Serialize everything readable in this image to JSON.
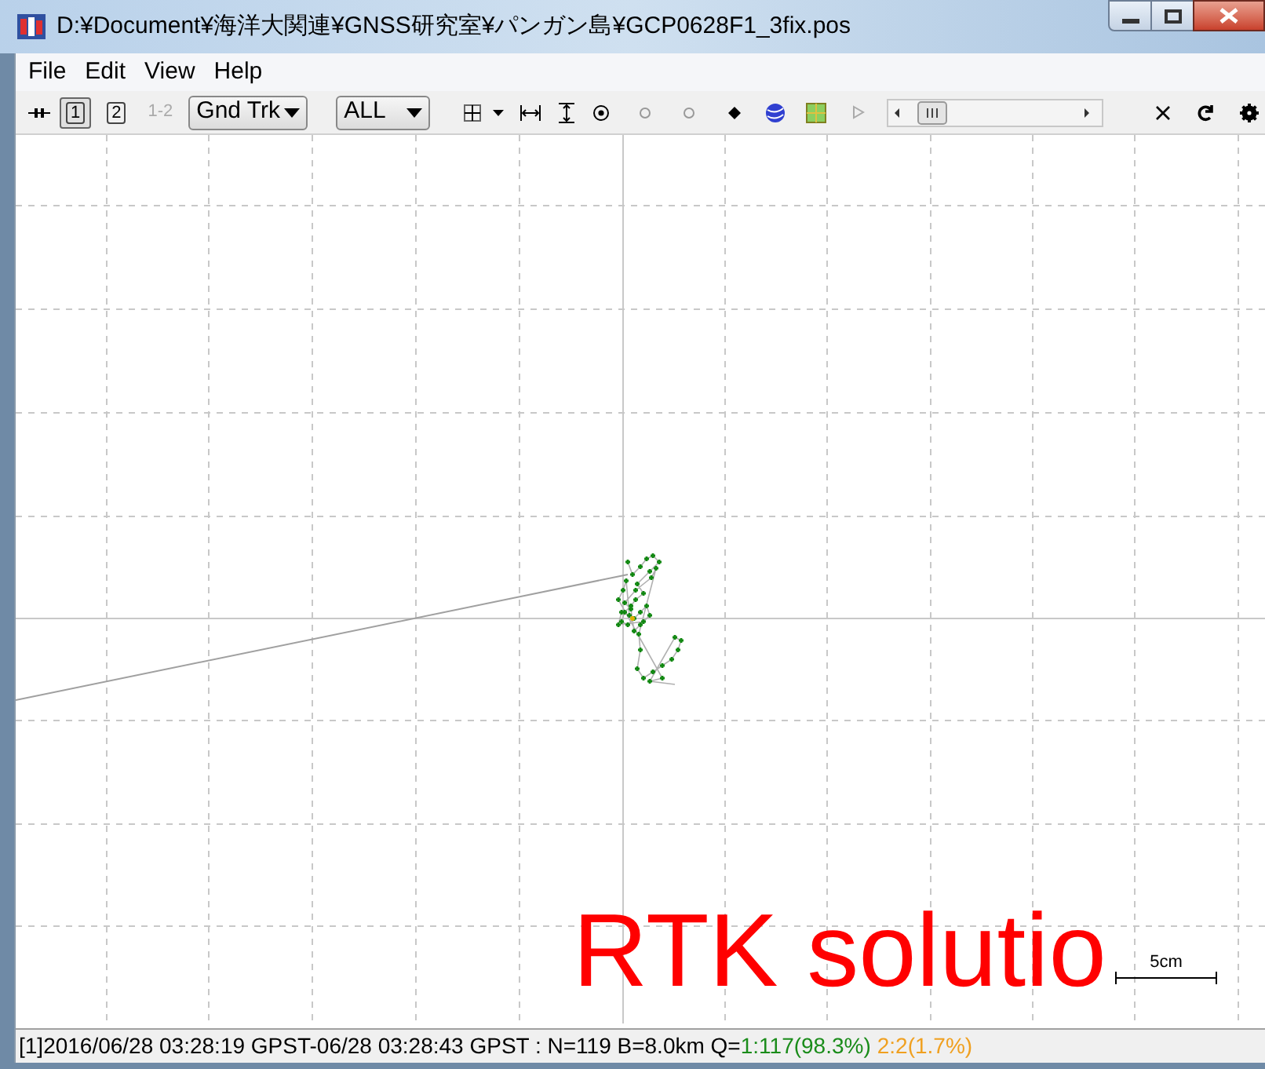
{
  "window": {
    "title": "D:¥Document¥海洋大関連¥GNSS研究室¥パンガン島¥GCP0628F1_3fix.pos"
  },
  "menu": [
    "File",
    "Edit",
    "View",
    "Help"
  ],
  "toolbar": {
    "plot_buttons": [
      {
        "label": "1",
        "selected": true
      },
      {
        "label": "2",
        "selected": false
      },
      {
        "label": "1-2",
        "selected": false,
        "disabled": true
      }
    ],
    "plot_type": "Gnd Trk",
    "quality": "ALL"
  },
  "plot": {
    "scale_label": "5cm",
    "annotation": "RTK solutio"
  },
  "status_bar": [
    {
      "text": "[1]2016/06/28 03:28:19 GPST-06/28 03:28:43 GPST : N=119 B=8.0km Q=",
      "color": "#000000"
    },
    {
      "text": "1:117(98.3%)",
      "color": "#1a8c1a"
    },
    {
      "text": "2:2(1.7%)",
      "color": "#f0a020"
    }
  ]
}
